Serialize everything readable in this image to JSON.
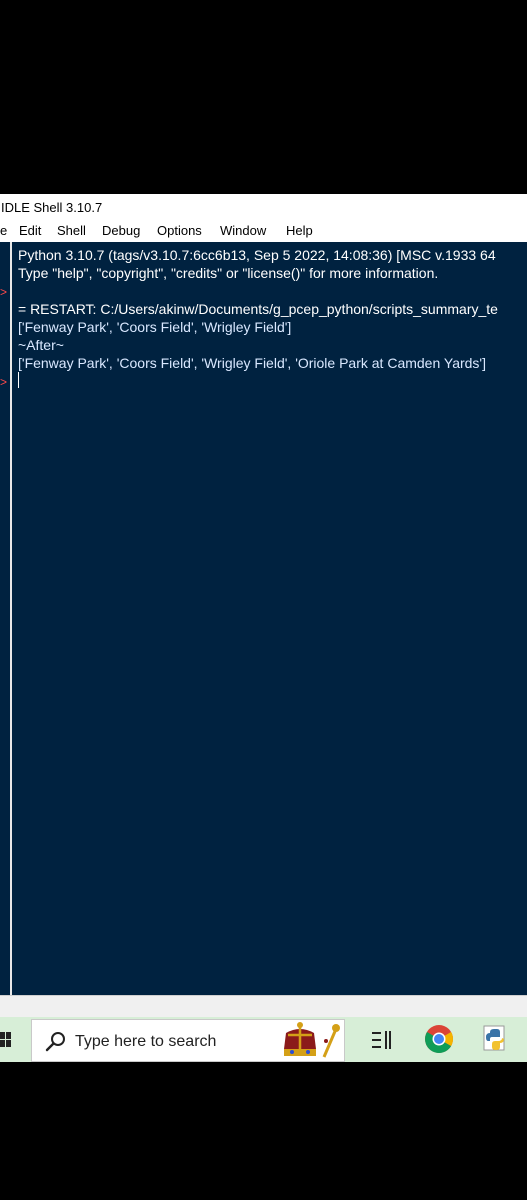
{
  "window": {
    "title": "IDLE Shell 3.10.7"
  },
  "menu": [
    "e",
    "Edit",
    "Shell",
    "Debug",
    "Options",
    "Window",
    "Help"
  ],
  "shell": {
    "lines": [
      "Python 3.10.7 (tags/v3.10.7:6cc6b13, Sep  5 2022, 14:08:36) [MSC v.1933 64",
      "Type \"help\", \"copyright\", \"credits\" or \"license()\" for more information.",
      "",
      "= RESTART: C:/Users/akinw/Documents/g_pcep_python/scripts_summary_te",
      "['Fenway Park', 'Coors Field', 'Wrigley Field']",
      "~After~",
      "['Fenway Park', 'Coors Field', 'Wrigley Field', 'Oriole Park at Camden Yards']"
    ],
    "prompt_symbol": ">"
  },
  "taskbar": {
    "search_placeholder": "Type here to search",
    "icons": [
      "windows-start-icon",
      "crown-icon",
      "task-view-icon",
      "chrome-icon",
      "python-icon"
    ]
  },
  "colors": {
    "shell_bg": "#002240",
    "text": "#ffffff",
    "prompt": "#ff4a4a",
    "taskbar_bg": "#d7eed7"
  }
}
